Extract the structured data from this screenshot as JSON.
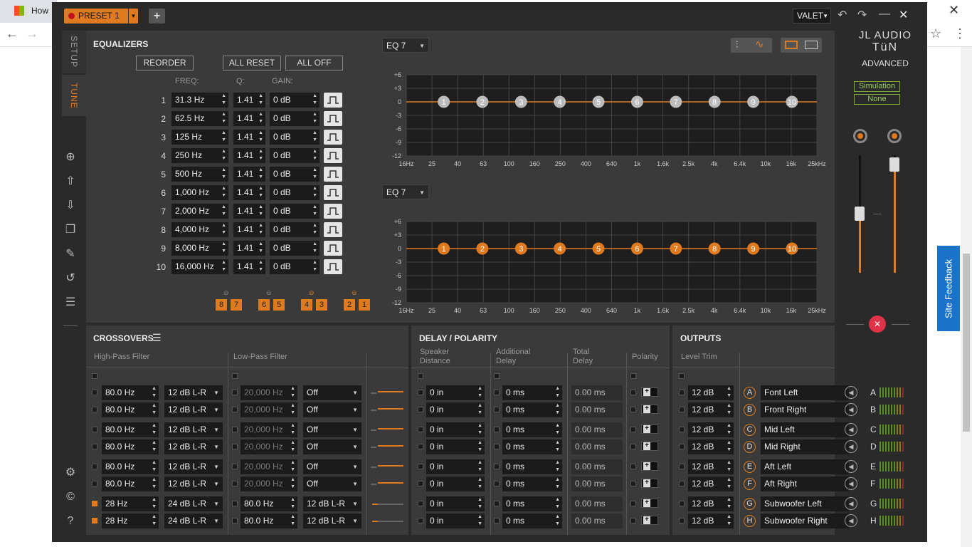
{
  "browser": {
    "tab_title": "How",
    "feedback": "Site Feedback"
  },
  "titlebar": {
    "preset": "PRESET 1",
    "add": "+",
    "valet": "VALET"
  },
  "rail": {
    "setup": "SETUP",
    "tune": "TUNE"
  },
  "brand": {
    "line1": "JL AUDIO",
    "line2": "TüN",
    "line3": "ADVANCED",
    "sim": "Simulation",
    "none": "None"
  },
  "eq": {
    "title": "EQUALIZERS",
    "reorder": "REORDER",
    "all_reset": "ALL RESET",
    "all_off": "ALL OFF",
    "freq_label": "FREQ:",
    "q_label": "Q:",
    "gain_label": "GAIN:",
    "bands": [
      {
        "n": "1",
        "freq": "31.3 Hz",
        "q": "1.41",
        "gain": "0 dB"
      },
      {
        "n": "2",
        "freq": "62.5 Hz",
        "q": "1.41",
        "gain": "0 dB"
      },
      {
        "n": "3",
        "freq": "125 Hz",
        "q": "1.41",
        "gain": "0 dB"
      },
      {
        "n": "4",
        "freq": "250 Hz",
        "q": "1.41",
        "gain": "0 dB"
      },
      {
        "n": "5",
        "freq": "500 Hz",
        "q": "1.41",
        "gain": "0 dB"
      },
      {
        "n": "6",
        "freq": "1,000 Hz",
        "q": "1.41",
        "gain": "0 dB"
      },
      {
        "n": "7",
        "freq": "2,000 Hz",
        "q": "1.41",
        "gain": "0 dB"
      },
      {
        "n": "8",
        "freq": "4,000 Hz",
        "q": "1.41",
        "gain": "0 dB"
      },
      {
        "n": "9",
        "freq": "8,000 Hz",
        "q": "1.41",
        "gain": "0 dB"
      },
      {
        "n": "10",
        "freq": "16,000 Hz",
        "q": "1.41",
        "gain": "0 dB"
      }
    ],
    "links": [
      "8",
      "7",
      "6",
      "5",
      "4",
      "3",
      "2",
      "1"
    ],
    "graph_select": "EQ 7",
    "yticks": [
      "+6",
      "+3",
      "0",
      "-3",
      "-6",
      "-9",
      "-12"
    ],
    "xticks": [
      "16Hz",
      "25",
      "40",
      "63",
      "100",
      "160",
      "250",
      "400",
      "640",
      "1k",
      "1.6k",
      "2.5k",
      "4k",
      "6.4k",
      "10k",
      "16k",
      "25kHz"
    ],
    "nodes": [
      "1",
      "2",
      "3",
      "4",
      "5",
      "6",
      "7",
      "8",
      "9",
      "10"
    ]
  },
  "crossovers": {
    "title": "CROSSOVERS",
    "hpf": "High-Pass Filter",
    "lpf": "Low-Pass Filter",
    "rows": [
      {
        "hp": "80.0 Hz",
        "hps": "12 dB L-R",
        "lp": "20,000 Hz",
        "lps": "Off",
        "on": false,
        "lpon": false
      },
      {
        "hp": "80.0 Hz",
        "hps": "12 dB L-R",
        "lp": "20,000 Hz",
        "lps": "Off",
        "on": false,
        "lpon": false
      },
      {
        "hp": "80.0 Hz",
        "hps": "12 dB L-R",
        "lp": "20,000 Hz",
        "lps": "Off",
        "on": false,
        "lpon": false
      },
      {
        "hp": "80.0 Hz",
        "hps": "12 dB L-R",
        "lp": "20,000 Hz",
        "lps": "Off",
        "on": false,
        "lpon": false
      },
      {
        "hp": "80.0 Hz",
        "hps": "12 dB L-R",
        "lp": "20,000 Hz",
        "lps": "Off",
        "on": false,
        "lpon": false
      },
      {
        "hp": "80.0 Hz",
        "hps": "12 dB L-R",
        "lp": "20,000 Hz",
        "lps": "Off",
        "on": false,
        "lpon": false
      },
      {
        "hp": "28 Hz",
        "hps": "24 dB L-R",
        "lp": "80.0 Hz",
        "lps": "12 dB L-R",
        "on": true,
        "lpon": true
      },
      {
        "hp": "28 Hz",
        "hps": "24 dB L-R",
        "lp": "80.0 Hz",
        "lps": "12 dB L-R",
        "on": true,
        "lpon": true
      }
    ]
  },
  "delay": {
    "title": "DELAY / POLARITY",
    "speaker1": "Speaker",
    "speaker2": "Distance",
    "add1": "Additional",
    "add2": "Delay",
    "total1": "Total",
    "total2": "Delay",
    "polarity": "Polarity",
    "rows": [
      {
        "dist": "0 in",
        "add": "0 ms",
        "total": "0.00 ms"
      },
      {
        "dist": "0 in",
        "add": "0 ms",
        "total": "0.00 ms"
      },
      {
        "dist": "0 in",
        "add": "0 ms",
        "total": "0.00 ms"
      },
      {
        "dist": "0 in",
        "add": "0 ms",
        "total": "0.00 ms"
      },
      {
        "dist": "0 in",
        "add": "0 ms",
        "total": "0.00 ms"
      },
      {
        "dist": "0 in",
        "add": "0 ms",
        "total": "0.00 ms"
      },
      {
        "dist": "0 in",
        "add": "0 ms",
        "total": "0.00 ms"
      },
      {
        "dist": "0 in",
        "add": "0 ms",
        "total": "0.00 ms"
      }
    ]
  },
  "outputs": {
    "title": "OUTPUTS",
    "trim": "Level Trim",
    "rows": [
      {
        "trim": "12 dB",
        "letter": "A",
        "name": "Font Left"
      },
      {
        "trim": "12 dB",
        "letter": "B",
        "name": "Front Right"
      },
      {
        "trim": "12 dB",
        "letter": "C",
        "name": "Mid Left"
      },
      {
        "trim": "12 dB",
        "letter": "D",
        "name": "Mid Right"
      },
      {
        "trim": "12 dB",
        "letter": "E",
        "name": "Aft Left"
      },
      {
        "trim": "12 dB",
        "letter": "F",
        "name": "Aft Right"
      },
      {
        "trim": "12 dB",
        "letter": "G",
        "name": "Subwoofer Left"
      },
      {
        "trim": "12 dB",
        "letter": "H",
        "name": "Subwoofer Right"
      }
    ]
  },
  "colors": {
    "accent": "#e07a1f",
    "panel": "#3a3a3a",
    "bg": "#2a2a2a",
    "field": "#1b1b1b"
  }
}
